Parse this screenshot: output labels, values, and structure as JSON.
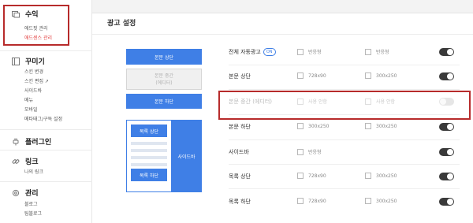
{
  "sidebar": {
    "groups": [
      {
        "title": "수익",
        "icon": "revenue-icon",
        "items": [
          {
            "label": "애드핏 관리",
            "active": false
          },
          {
            "label": "애드센스 관리",
            "active": true
          }
        ]
      },
      {
        "title": "꾸미기",
        "icon": "layout-icon",
        "items": [
          {
            "label": "스킨 변경"
          },
          {
            "label": "스킨 편집 ↗"
          },
          {
            "label": "사이드바"
          },
          {
            "label": "메뉴"
          },
          {
            "label": "모바일"
          },
          {
            "label": "메타태그/구독 설정"
          }
        ]
      },
      {
        "title": "플러그인",
        "icon": "plug-icon",
        "items": []
      },
      {
        "title": "링크",
        "icon": "link-icon",
        "items": [
          {
            "label": "나의 링크"
          }
        ]
      },
      {
        "title": "관리",
        "icon": "gear-icon",
        "items": [
          {
            "label": "블로그"
          },
          {
            "label": "팀블로그"
          }
        ]
      }
    ]
  },
  "main": {
    "title": "광고 설정",
    "preview": {
      "body_top": "본문 상단",
      "body_middle": "본문 중간\n(에디터)",
      "body_bottom": "본문 하단",
      "list_top": "목록 상단",
      "list_bottom": "목록 하단",
      "sidebar": "사이드바"
    },
    "rows": [
      {
        "label": "전체 자동광고",
        "badge": "ON",
        "opt1": "반응형",
        "opt2": "반응형",
        "on": true,
        "dim": false
      },
      {
        "label": "본문 상단",
        "opt1": "728x90",
        "opt2": "300x250",
        "on": true,
        "dim": false
      },
      {
        "label": "본문 중간 (에디터)",
        "opt1": "사용 안함",
        "opt2": "사용 안함",
        "on": false,
        "dim": true
      },
      {
        "label": "본문 하단",
        "opt1": "300x250",
        "opt2": "300x250",
        "on": true,
        "dim": false
      },
      {
        "label": "사이드바",
        "opt1": "반응형",
        "opt2": "",
        "on": true,
        "dim": false
      },
      {
        "label": "목록 상단",
        "opt1": "728x90",
        "opt2": "300x250",
        "on": true,
        "dim": false
      },
      {
        "label": "목록 하단",
        "opt1": "728x90",
        "opt2": "300x250",
        "on": true,
        "dim": false
      }
    ]
  }
}
